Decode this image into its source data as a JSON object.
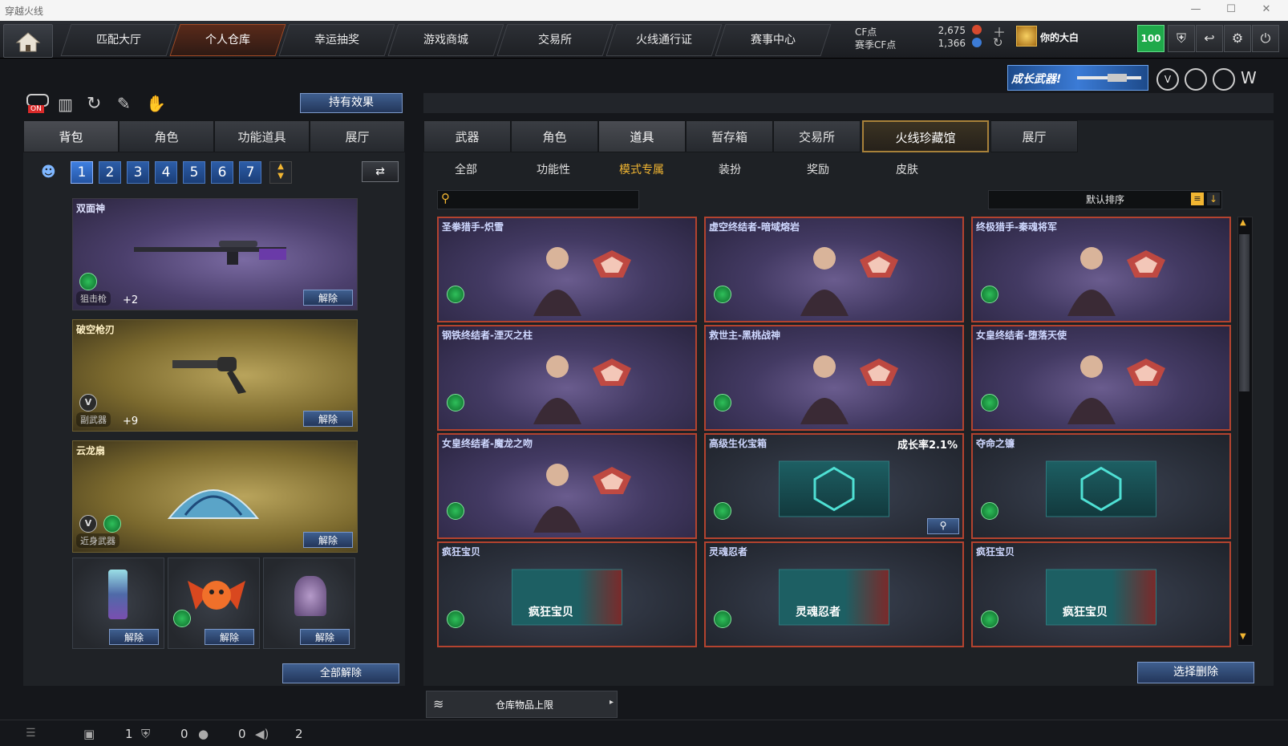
{
  "window": {
    "title": "穿越火线"
  },
  "nav": {
    "tabs": [
      "匹配大厅",
      "个人仓库",
      "幸运抽奖",
      "游戏商城",
      "交易所",
      "火线通行证",
      "赛事中心"
    ],
    "active_index": 1
  },
  "currency": {
    "cf_label": "CF点",
    "cf_value": "2,675",
    "season_label": "赛季CF点",
    "season_value": "1,366"
  },
  "user": {
    "name": "你的大白",
    "level": "100"
  },
  "promo": {
    "text": "成长武器!"
  },
  "left": {
    "on_label": "ON",
    "effect_button": "持有效果",
    "tabs": [
      "背包",
      "角色",
      "功能道具",
      "展厅"
    ],
    "active_tab": 0,
    "pages": [
      "1",
      "2",
      "3",
      "4",
      "5",
      "6",
      "7"
    ],
    "active_page": 0,
    "slots": [
      {
        "name": "双面神",
        "class": "狙击枪",
        "plus": "+2",
        "remove": "解除"
      },
      {
        "name": "破空枪刃",
        "class": "副武器",
        "plus": "+9",
        "remove": "解除"
      },
      {
        "name": "云龙扇",
        "class": "近身武器",
        "remove": "解除"
      }
    ],
    "small_slots": [
      {
        "remove": "解除"
      },
      {
        "remove": "解除"
      },
      {
        "remove": "解除"
      }
    ],
    "remove_all": "全部解除"
  },
  "right": {
    "tabs": [
      "武器",
      "角色",
      "道具",
      "暂存箱",
      "交易所",
      "火线珍藏馆",
      "展厅"
    ],
    "active_tab": 2,
    "highlight_tab": 5,
    "subtabs": [
      "全部",
      "功能性",
      "模式专属",
      "装扮",
      "奖励",
      "皮肤"
    ],
    "active_subtab": 2,
    "search_placeholder": "",
    "sort_label": "默认排序",
    "items": [
      {
        "name": "圣拳猎手-炽雪",
        "type": "char"
      },
      {
        "name": "虚空终结者-暗域熔岩",
        "type": "char"
      },
      {
        "name": "终极猎手-秦魂将军",
        "type": "char"
      },
      {
        "name": "钢铁终结者-湮灭之柱",
        "type": "char"
      },
      {
        "name": "救世主-黑桃战神",
        "type": "char"
      },
      {
        "name": "女皇终结者-堕落天使",
        "type": "char"
      },
      {
        "name": "女皇终结者-魔龙之吻",
        "type": "char"
      },
      {
        "name": "高级生化宝箱",
        "type": "box",
        "rate": "成长率2.1%"
      },
      {
        "name": "夺命之镰",
        "type": "box"
      },
      {
        "name": "疯狂宝贝",
        "type": "card",
        "card_label": "疯狂宝贝"
      },
      {
        "name": "灵魂忍者",
        "type": "card",
        "card_label": "灵魂忍者"
      },
      {
        "name": "疯狂宝贝",
        "type": "card",
        "card_label": "疯狂宝贝"
      }
    ],
    "select_delete": "选择删除",
    "warehouse_limit": "仓库物品上限"
  },
  "bottom": {
    "counts": [
      "1",
      "0",
      "0",
      "2"
    ]
  },
  "colors": {
    "accent_gold": "#f2b632",
    "card_border": "#b3432f",
    "level_green": "#1fa94a"
  }
}
